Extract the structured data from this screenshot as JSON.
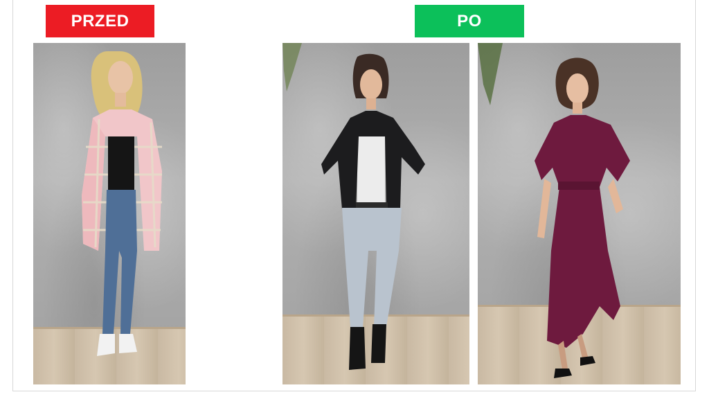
{
  "labels": {
    "before": "PRZED",
    "after": "PO"
  },
  "colors": {
    "before_label_bg": "#ec1c24",
    "after_label_bg": "#0cc05a",
    "label_text": "#ffffff"
  }
}
